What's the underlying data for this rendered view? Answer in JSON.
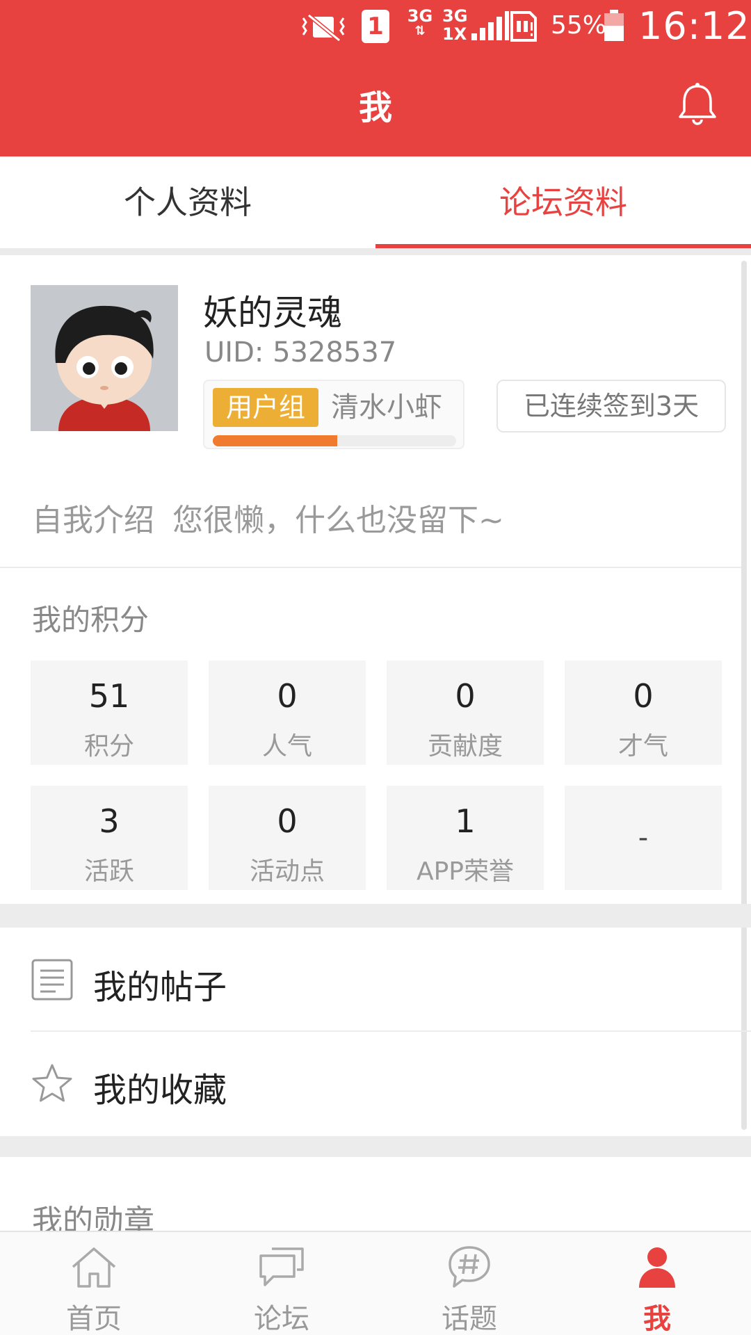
{
  "status_bar": {
    "sim_slot": "1",
    "network_1": "3G",
    "network_2_top": "3G",
    "network_2_bottom": "1X",
    "battery_percent": "55%",
    "battery_level": 0.55,
    "time": "16:12"
  },
  "header": {
    "title": "我"
  },
  "tabs": [
    {
      "label": "个人资料",
      "active": false
    },
    {
      "label": "论坛资料",
      "active": true
    }
  ],
  "profile": {
    "username": "妖的灵魂",
    "uid": "UID: 5328537",
    "group_label": "用户组",
    "group_value": "清水小虾",
    "group_progress": 0.51,
    "signin_text": "已连续签到3天",
    "intro_label": "自我介绍",
    "intro_value": "您很懒，什么也没留下~"
  },
  "points": {
    "title": "我的积分",
    "cells": [
      {
        "value": "51",
        "label": "积分"
      },
      {
        "value": "0",
        "label": "人气"
      },
      {
        "value": "0",
        "label": "贡献度"
      },
      {
        "value": "0",
        "label": "才气"
      },
      {
        "value": "3",
        "label": "活跃"
      },
      {
        "value": "0",
        "label": "活动点"
      },
      {
        "value": "1",
        "label": "APP荣誉"
      },
      {
        "value": "-",
        "label": ""
      }
    ]
  },
  "menu": [
    {
      "label": "我的帖子",
      "icon": "document-icon"
    },
    {
      "label": "我的收藏",
      "icon": "star-icon"
    }
  ],
  "medals": {
    "title": "我的勋章"
  },
  "bottom_nav": [
    {
      "label": "首页",
      "icon": "home-icon",
      "active": false
    },
    {
      "label": "论坛",
      "icon": "chat-icon",
      "active": false
    },
    {
      "label": "话题",
      "icon": "hashtag-icon",
      "active": false
    },
    {
      "label": "我",
      "icon": "person-icon",
      "active": true
    }
  ],
  "colors": {
    "accent": "#E84240",
    "group_badge": "#EDAE35",
    "progress": "#F07A2E"
  }
}
